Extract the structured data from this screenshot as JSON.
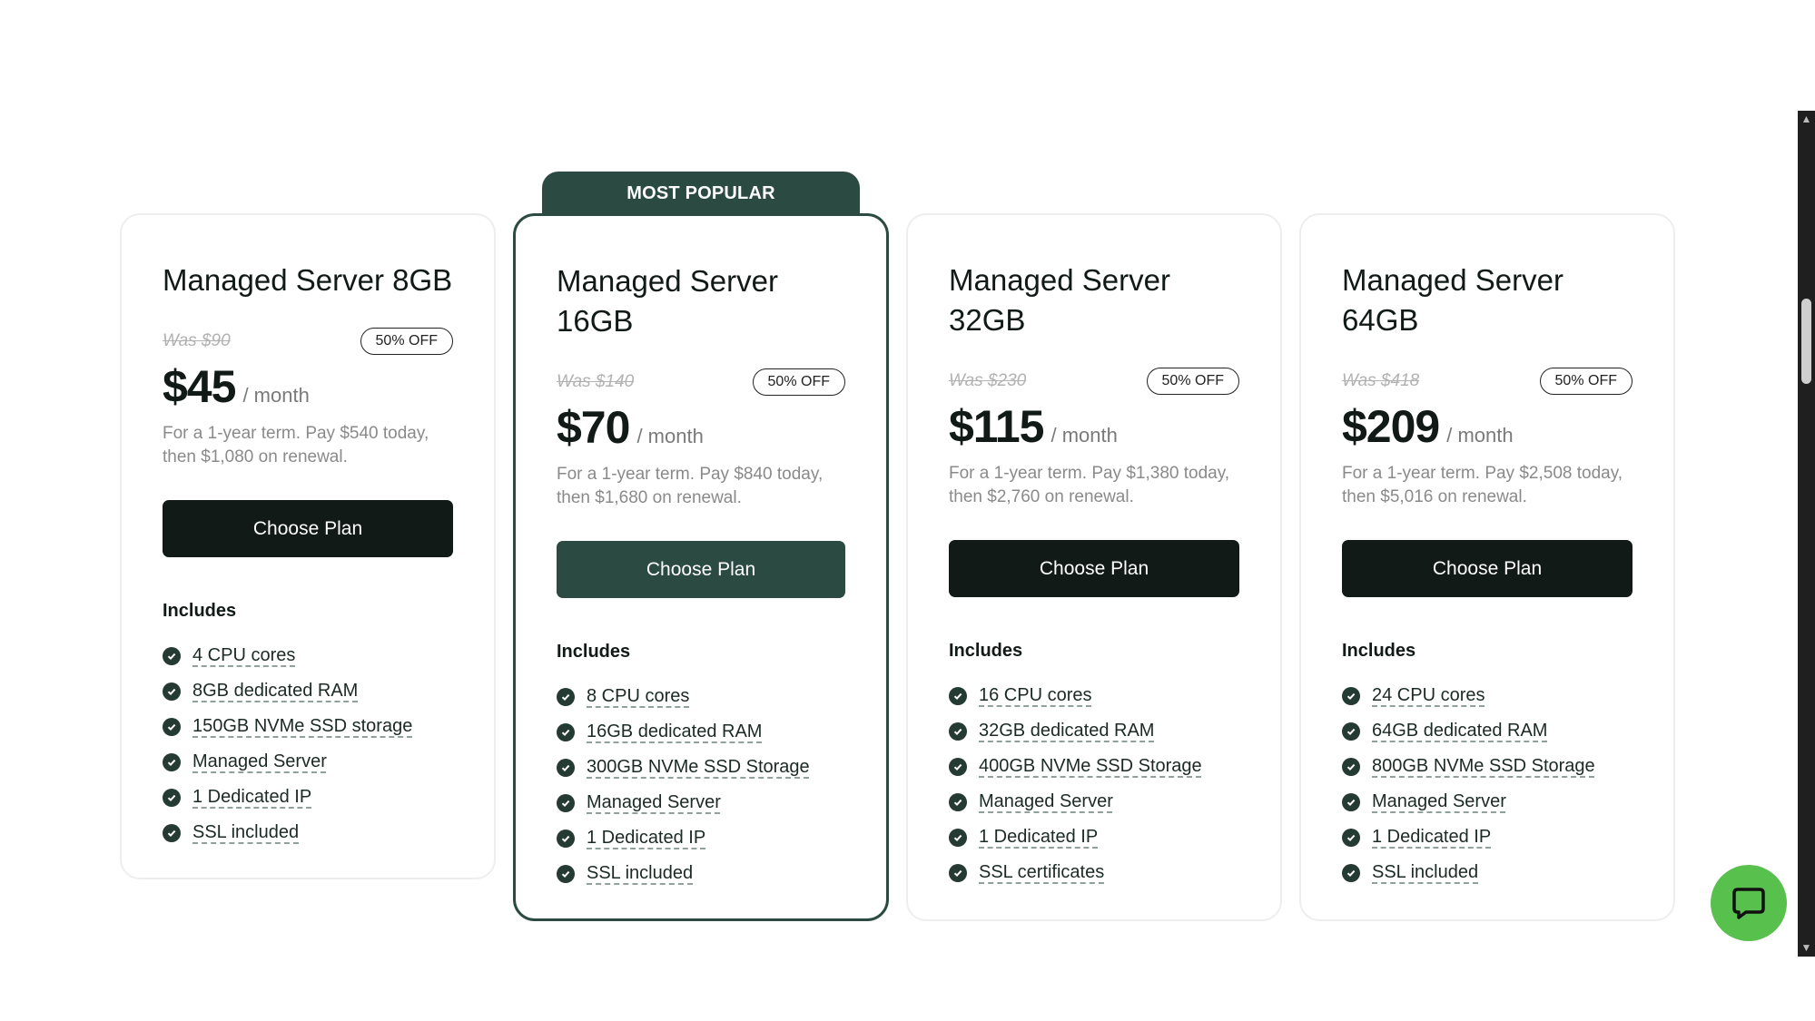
{
  "popular_label": "MOST POPULAR",
  "plans": [
    {
      "name": "Managed Server 8GB",
      "was": "Was $90",
      "badge": "50% OFF",
      "price": "$45",
      "per": "/ month",
      "term": "For a 1-year term. Pay $540 today, then $1,080 on renewal.",
      "button": "Choose Plan",
      "includes_label": "Includes",
      "features": [
        "4 CPU cores",
        "8GB dedicated RAM",
        "150GB NVMe SSD storage",
        "Managed Server",
        "1 Dedicated IP",
        "SSL included"
      ]
    },
    {
      "name": "Managed Server 16GB",
      "was": "Was $140",
      "badge": "50% OFF",
      "price": "$70",
      "per": "/ month",
      "term": "For a 1-year term. Pay $840 today, then $1,680 on renewal.",
      "button": "Choose Plan",
      "includes_label": "Includes",
      "features": [
        "8 CPU cores",
        "16GB dedicated RAM",
        "300GB NVMe SSD Storage",
        "Managed Server",
        "1 Dedicated IP",
        "SSL included"
      ]
    },
    {
      "name": "Managed Server 32GB",
      "was": "Was $230",
      "badge": "50% OFF",
      "price": "$115",
      "per": "/ month",
      "term": "For a 1-year term. Pay $1,380 today, then $2,760 on renewal.",
      "button": "Choose Plan",
      "includes_label": "Includes",
      "features": [
        "16 CPU cores",
        "32GB dedicated RAM",
        "400GB NVMe SSD Storage",
        "Managed Server",
        "1 Dedicated IP",
        "SSL certificates"
      ]
    },
    {
      "name": "Managed Server 64GB",
      "was": "Was $418",
      "badge": "50% OFF",
      "price": "$209",
      "per": "/ month",
      "term": "For a 1-year term. Pay $2,508 today, then $5,016 on renewal.",
      "button": "Choose Plan",
      "includes_label": "Includes",
      "features": [
        "24 CPU cores",
        "64GB dedicated RAM",
        "800GB NVMe SSD Storage",
        "Managed Server",
        "1 Dedicated IP",
        "SSL included"
      ]
    }
  ],
  "icons": {
    "feature": "check-circle-icon",
    "chat": "chat-bubble-icon",
    "scroll_up": "arrow-up-icon",
    "scroll_down": "arrow-down-icon"
  },
  "colors": {
    "accent_green": "#2b4a41",
    "dark_button": "#111a17",
    "chat_green": "#58c04c"
  }
}
